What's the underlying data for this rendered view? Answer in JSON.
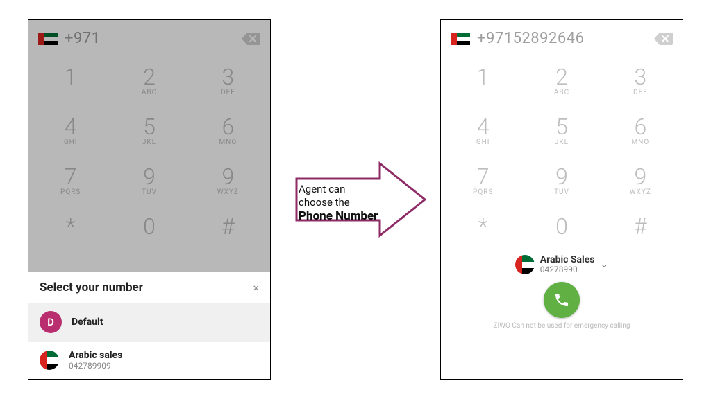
{
  "left": {
    "header": {
      "number": "+971"
    },
    "keypad": [
      {
        "digit": "1",
        "letters": ""
      },
      {
        "digit": "2",
        "letters": "ABC"
      },
      {
        "digit": "3",
        "letters": "DEF"
      },
      {
        "digit": "4",
        "letters": "GHI"
      },
      {
        "digit": "5",
        "letters": "JKL"
      },
      {
        "digit": "6",
        "letters": "MNO"
      },
      {
        "digit": "7",
        "letters": "PQRS"
      },
      {
        "digit": "9",
        "letters": "TUV"
      },
      {
        "digit": "9",
        "letters": "WXYZ"
      },
      {
        "digit": "*",
        "letters": ""
      },
      {
        "digit": "0",
        "letters": ""
      },
      {
        "digit": "#",
        "letters": ""
      }
    ],
    "sheet": {
      "title": "Select your number",
      "close_glyph": "×",
      "options": [
        {
          "lead_initial": "D",
          "label": "Default",
          "sub": ""
        },
        {
          "label": "Arabic sales",
          "sub": "042789909"
        }
      ]
    }
  },
  "arrow": {
    "line1": "Agent can",
    "line2": "choose the",
    "line3": "Phone Number",
    "stroke": "#8e2b66"
  },
  "right": {
    "header": {
      "number": "+97152892646"
    },
    "keypad": [
      {
        "digit": "1",
        "letters": ""
      },
      {
        "digit": "2",
        "letters": "ABC"
      },
      {
        "digit": "3",
        "letters": "DEF"
      },
      {
        "digit": "4",
        "letters": "GHI"
      },
      {
        "digit": "5",
        "letters": "JKL"
      },
      {
        "digit": "6",
        "letters": "MNO"
      },
      {
        "digit": "7",
        "letters": "PQRS"
      },
      {
        "digit": "9",
        "letters": "TUV"
      },
      {
        "digit": "9",
        "letters": "WXYZ"
      },
      {
        "digit": "*",
        "letters": ""
      },
      {
        "digit": "0",
        "letters": ""
      },
      {
        "digit": "#",
        "letters": ""
      }
    ],
    "selected_line": {
      "name": "Arabic Sales",
      "number": "04278990",
      "chevron": "⌄"
    },
    "disclaimer": "ZIWO Can not be used for emergency calling"
  }
}
